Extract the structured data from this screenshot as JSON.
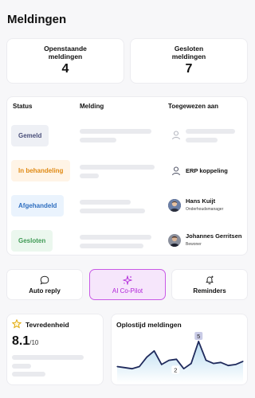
{
  "page": {
    "title": "Meldingen"
  },
  "stats": [
    {
      "label": "Openstaande meldingen",
      "value": "4"
    },
    {
      "label": "Gesloten meldingen",
      "value": "7"
    }
  ],
  "table": {
    "headers": [
      "Status",
      "Melding",
      "Toegewezen aan"
    ],
    "rows": [
      {
        "status": "Gemeld",
        "status_color": "#4a4f7a",
        "status_bg": "#eef0f5",
        "assignee": "",
        "role": "",
        "assignee_type": "placeholder"
      },
      {
        "status": "In behandeling",
        "status_color": "#e08a14",
        "status_bg": "#fff4e6",
        "assignee": "ERP koppeling",
        "role": "",
        "assignee_type": "system"
      },
      {
        "status": "Afgehandeld",
        "status_color": "#2f6fc0",
        "status_bg": "#eaf3fd",
        "assignee": "Hans Kuijt",
        "role": "Onderhoudsmanager",
        "assignee_type": "person"
      },
      {
        "status": "Gesloten",
        "status_color": "#3f9a55",
        "status_bg": "#ebf7ee",
        "assignee": "Johannes Gerritsen",
        "role": "Bewoner",
        "assignee_type": "person"
      }
    ]
  },
  "actions": [
    {
      "label": "Auto reply",
      "icon": "chat-bubble-icon"
    },
    {
      "label": "AI Co-Pilot",
      "icon": "sparkles-icon",
      "active": true,
      "accent": "#b023d8"
    },
    {
      "label": "Reminders",
      "icon": "bell-plus-icon"
    }
  ],
  "satisfaction": {
    "title": "Tevredenheid",
    "score": "8.1",
    "suffix": "/10",
    "icon": "star-icon"
  },
  "resolution": {
    "title": "Oplostijd meldingen",
    "peak_label": "5",
    "low_label": "2"
  },
  "chart_data": {
    "type": "area",
    "title": "Oplostijd meldingen",
    "values": [
      2.6,
      2.5,
      2.4,
      2.6,
      3.5,
      4.1,
      2.8,
      3.2,
      3.3,
      2.4,
      2.9,
      5.0,
      3.2,
      2.9,
      3.0,
      2.7,
      2.8,
      3.1
    ],
    "labels": [
      {
        "index": 11,
        "text": "5"
      },
      {
        "index": 8,
        "text": "2"
      }
    ],
    "line_color": "#1f2a5c",
    "fill_top": "#b9dcf1",
    "fill_bottom": "#ffffff",
    "grid": false
  }
}
